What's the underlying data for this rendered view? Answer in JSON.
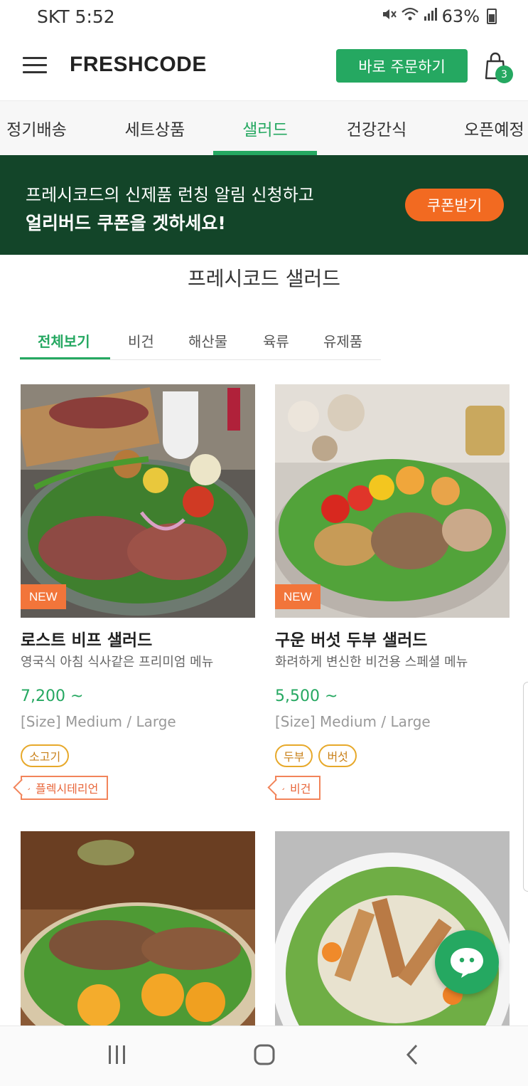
{
  "status_bar": {
    "carrier_time": "SKT 5:52",
    "battery": "63%"
  },
  "header": {
    "logo": "FRESHCODE",
    "order_button": "바로 주문하기",
    "cart_count": "3"
  },
  "category_nav": {
    "tabs": [
      {
        "label": "정기배송"
      },
      {
        "label": "세트상품"
      },
      {
        "label": "샐러드",
        "active": true
      },
      {
        "label": "건강간식"
      },
      {
        "label": "오픈예정"
      }
    ]
  },
  "banner": {
    "line1": "프레시코드의 신제품 런칭 알림 신청하고",
    "line2": "얼리버드 쿠폰을 겟하세요!",
    "button": "쿠폰받기"
  },
  "section": {
    "title": "프레시코드 샐러드",
    "subtabs": [
      {
        "label": "전체보기",
        "active": true
      },
      {
        "label": "비건"
      },
      {
        "label": "해산물"
      },
      {
        "label": "육류"
      },
      {
        "label": "유제품"
      }
    ]
  },
  "products": [
    {
      "badge": "NEW",
      "name": "로스트 비프 샐러드",
      "description": "영국식 아침 식사같은 프리미엄 메뉴",
      "price": "7,200 ~",
      "size": "[Size] Medium / Large",
      "tags": [
        "소고기"
      ],
      "diet": "플렉시테리언"
    },
    {
      "badge": "NEW",
      "name": "구운 버섯 두부 샐러드",
      "description": "화려하게 변신한 비건용 스페셜 메뉴",
      "price": "5,500 ~",
      "size": "[Size] Medium / Large",
      "tags": [
        "두부",
        "버섯"
      ],
      "diet": "비건"
    }
  ],
  "colors": {
    "brand_green": "#25a861",
    "banner_bg": "#134529",
    "coupon_orange": "#f26a21",
    "new_badge": "#f2753a"
  },
  "icons": [
    "menu-icon",
    "shopping-bag-icon",
    "chat-icon",
    "recent-apps-icon",
    "home-icon",
    "back-icon"
  ]
}
